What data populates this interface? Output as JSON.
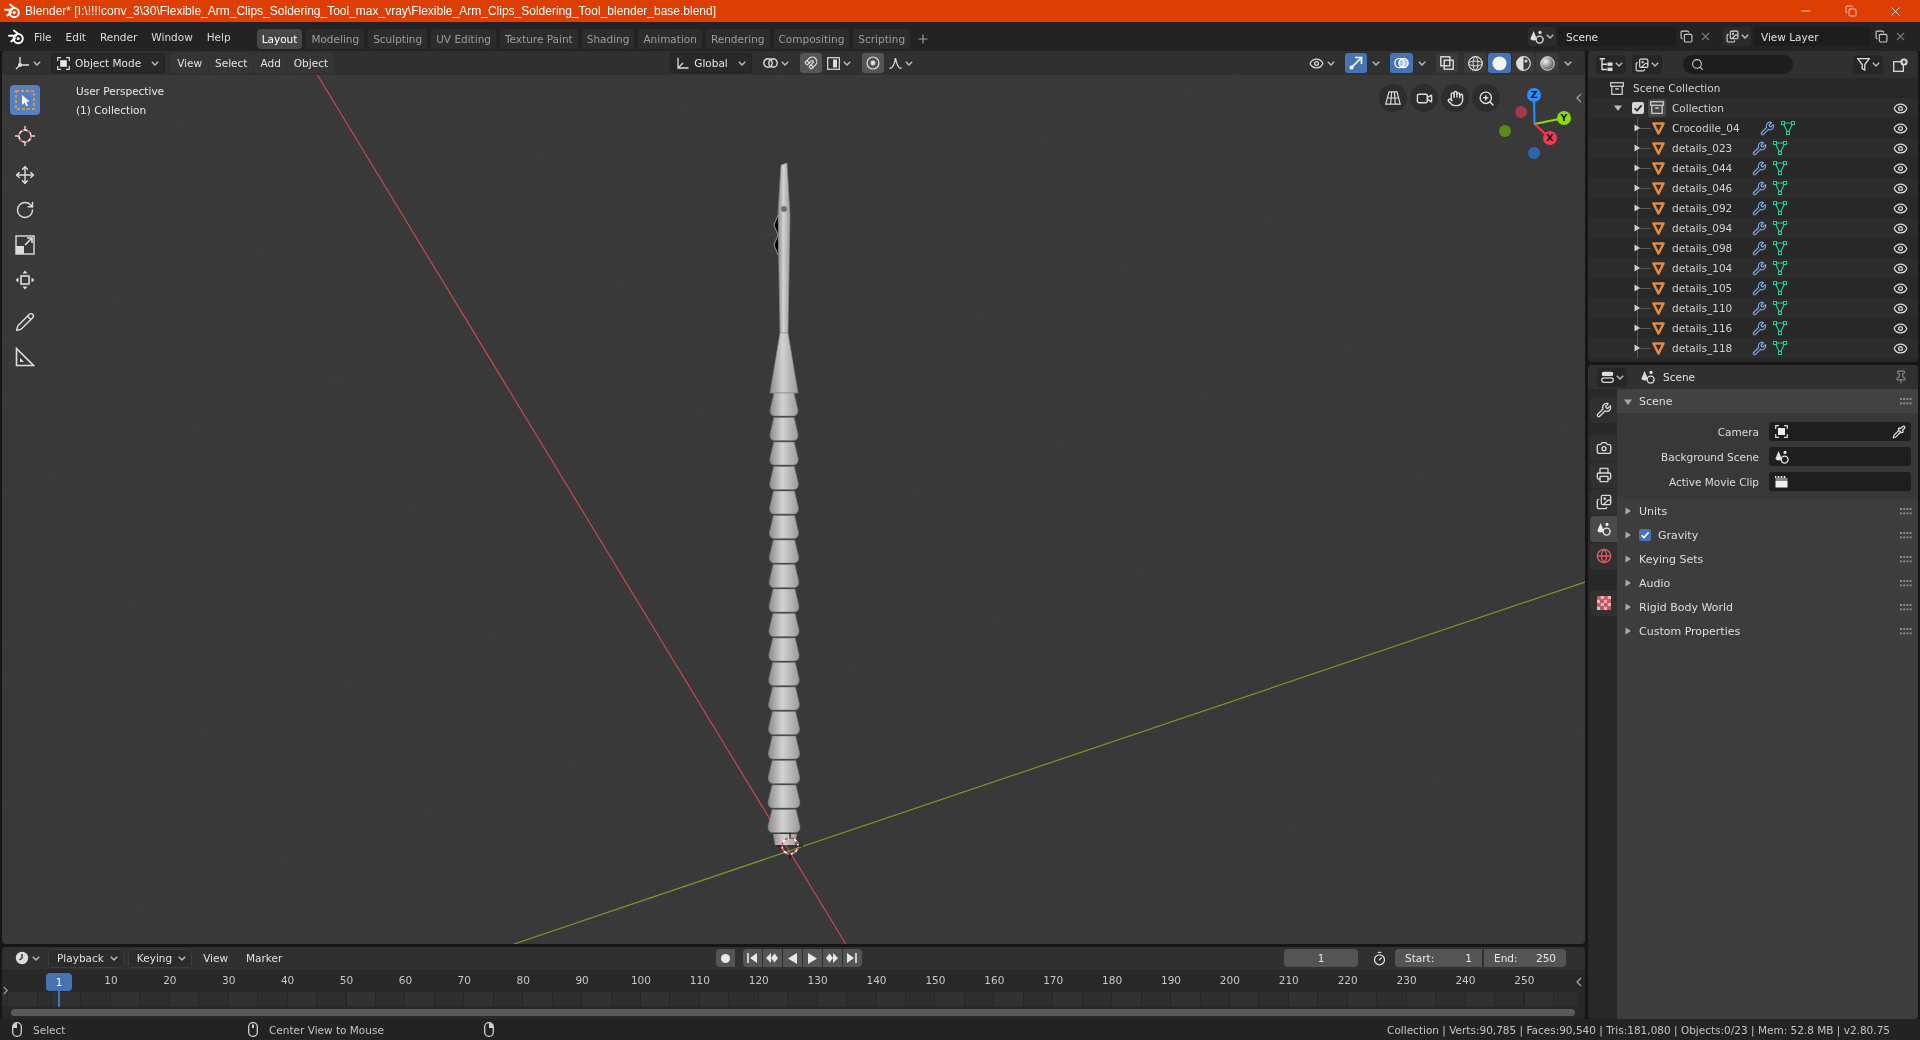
{
  "window": {
    "title": "Blender* [I:\\!!!!conv_3\\30\\Flexible_Arm_Clips_Soldering_Tool_max_vray\\Flexible_Arm_Clips_Soldering_Tool_blender_base.blend]"
  },
  "menu": [
    "File",
    "Edit",
    "Render",
    "Window",
    "Help"
  ],
  "workspaces": [
    {
      "label": "Layout",
      "selected": true
    },
    {
      "label": "Modeling",
      "selected": false
    },
    {
      "label": "Sculpting",
      "selected": false
    },
    {
      "label": "UV Editing",
      "selected": false
    },
    {
      "label": "Texture Paint",
      "selected": false
    },
    {
      "label": "Shading",
      "selected": false
    },
    {
      "label": "Animation",
      "selected": false
    },
    {
      "label": "Rendering",
      "selected": false
    },
    {
      "label": "Compositing",
      "selected": false
    },
    {
      "label": "Scripting",
      "selected": false
    }
  ],
  "scene": {
    "value": "Scene"
  },
  "view_layer": {
    "value": "View Layer"
  },
  "viewport": {
    "mode": "Object Mode",
    "menus": [
      "View",
      "Select",
      "Add",
      "Object"
    ],
    "orientation": "Global",
    "toggles": [
      {
        "kind": "gizmo",
        "on": true
      },
      {
        "kind": "overlays",
        "on": true
      },
      {
        "kind": "xray",
        "on": false
      }
    ],
    "shading": [
      {
        "kind": "wireframe",
        "selected": false
      },
      {
        "kind": "solid",
        "selected": true
      },
      {
        "kind": "material",
        "selected": false
      },
      {
        "kind": "rendered",
        "selected": false
      }
    ],
    "tools": [
      {
        "kind": "select_box",
        "selected": true
      },
      {
        "kind": "cursor",
        "selected": false
      },
      {
        "kind": "move",
        "selected": false
      },
      {
        "kind": "rotate",
        "selected": false
      },
      {
        "kind": "scale",
        "selected": false
      },
      {
        "kind": "transform",
        "selected": false
      },
      {
        "kind": "annotate",
        "selected": false
      },
      {
        "kind": "measure",
        "selected": false
      }
    ],
    "info": [
      "User Perspective",
      "(1) Collection"
    ],
    "axes": [
      {
        "label": "Z",
        "color": "#2890ff"
      },
      {
        "label": "Y",
        "color": "#8bdc00"
      },
      {
        "label": "X",
        "color": "#ff3352"
      }
    ],
    "negative_axes": [
      {
        "color": "#a63a4c"
      },
      {
        "color": "#5e8a1c"
      },
      {
        "color": "#2f65b0"
      }
    ]
  },
  "outliner": {
    "root": "Scene Collection",
    "collection": {
      "name": "Collection",
      "checked": true,
      "expanded": true,
      "visible": true,
      "children": [
        {
          "name": "Crocodile_04",
          "expanded": false,
          "visible": true
        },
        {
          "name": "details_023",
          "expanded": false,
          "visible": true
        },
        {
          "name": "details_044",
          "expanded": false,
          "visible": true
        },
        {
          "name": "details_046",
          "expanded": false,
          "visible": true
        },
        {
          "name": "details_092",
          "expanded": false,
          "visible": true
        },
        {
          "name": "details_094",
          "expanded": false,
          "visible": true
        },
        {
          "name": "details_098",
          "expanded": false,
          "visible": true
        },
        {
          "name": "details_104",
          "expanded": false,
          "visible": true
        },
        {
          "name": "details_105",
          "expanded": false,
          "visible": true
        },
        {
          "name": "details_110",
          "expanded": false,
          "visible": true
        },
        {
          "name": "details_116",
          "expanded": false,
          "visible": true
        },
        {
          "name": "details_118",
          "expanded": false,
          "visible": true
        }
      ]
    }
  },
  "properties": {
    "context": "Scene",
    "tabs": [
      {
        "kind": "tool",
        "selected": false
      },
      {
        "kind": "render",
        "selected": false
      },
      {
        "kind": "output",
        "selected": false
      },
      {
        "kind": "view_layer",
        "selected": false
      },
      {
        "kind": "scene",
        "selected": true
      },
      {
        "kind": "world",
        "selected": false
      },
      {
        "kind": "texture",
        "selected": false
      }
    ],
    "panels": [
      {
        "title": "Scene",
        "kind": "plain",
        "expanded": true,
        "fields": [
          {
            "label": "Camera",
            "kind": "camera"
          },
          {
            "label": "Background Scene",
            "kind": "scene"
          },
          {
            "label": "Active Movie Clip",
            "kind": "clip"
          }
        ]
      },
      {
        "title": "Units",
        "kind": "plain",
        "expanded": false
      },
      {
        "title": "Gravity",
        "kind": "toggle",
        "checked": true,
        "expanded": false
      },
      {
        "title": "Keying Sets",
        "kind": "plain",
        "expanded": false
      },
      {
        "title": "Audio",
        "kind": "plain",
        "expanded": false
      },
      {
        "title": "Rigid Body World",
        "kind": "plain",
        "expanded": false
      },
      {
        "title": "Custom Properties",
        "kind": "plain",
        "expanded": false
      }
    ]
  },
  "timeline": {
    "menus": [
      {
        "label": "Playback",
        "dropdown": true
      },
      {
        "label": "Keying",
        "dropdown": true
      },
      {
        "label": "View",
        "dropdown": false
      },
      {
        "label": "Marker",
        "dropdown": false
      }
    ],
    "current_frame": "1",
    "start": {
      "label": "Start:",
      "value": "1"
    },
    "end": {
      "label": "End:",
      "value": "250"
    },
    "playhead": "1",
    "ruler": [
      "10",
      "20",
      "30",
      "40",
      "50",
      "60",
      "70",
      "80",
      "90",
      "100",
      "110",
      "120",
      "130",
      "140",
      "150",
      "160",
      "170",
      "180",
      "190",
      "200",
      "210",
      "220",
      "230",
      "240",
      "250"
    ]
  },
  "status_bar": {
    "hints": [
      {
        "kind": "left_mouse",
        "label": "Select"
      },
      {
        "kind": "middle_mouse",
        "label": "Center View to Mouse"
      },
      {
        "kind": "right_mouse"
      }
    ],
    "stats": "Collection | Verts:90,785 | Faces:90,540 | Tris:181,080 | Objects:0/23 | Mem: 52.8 MB | v2.80.75"
  }
}
